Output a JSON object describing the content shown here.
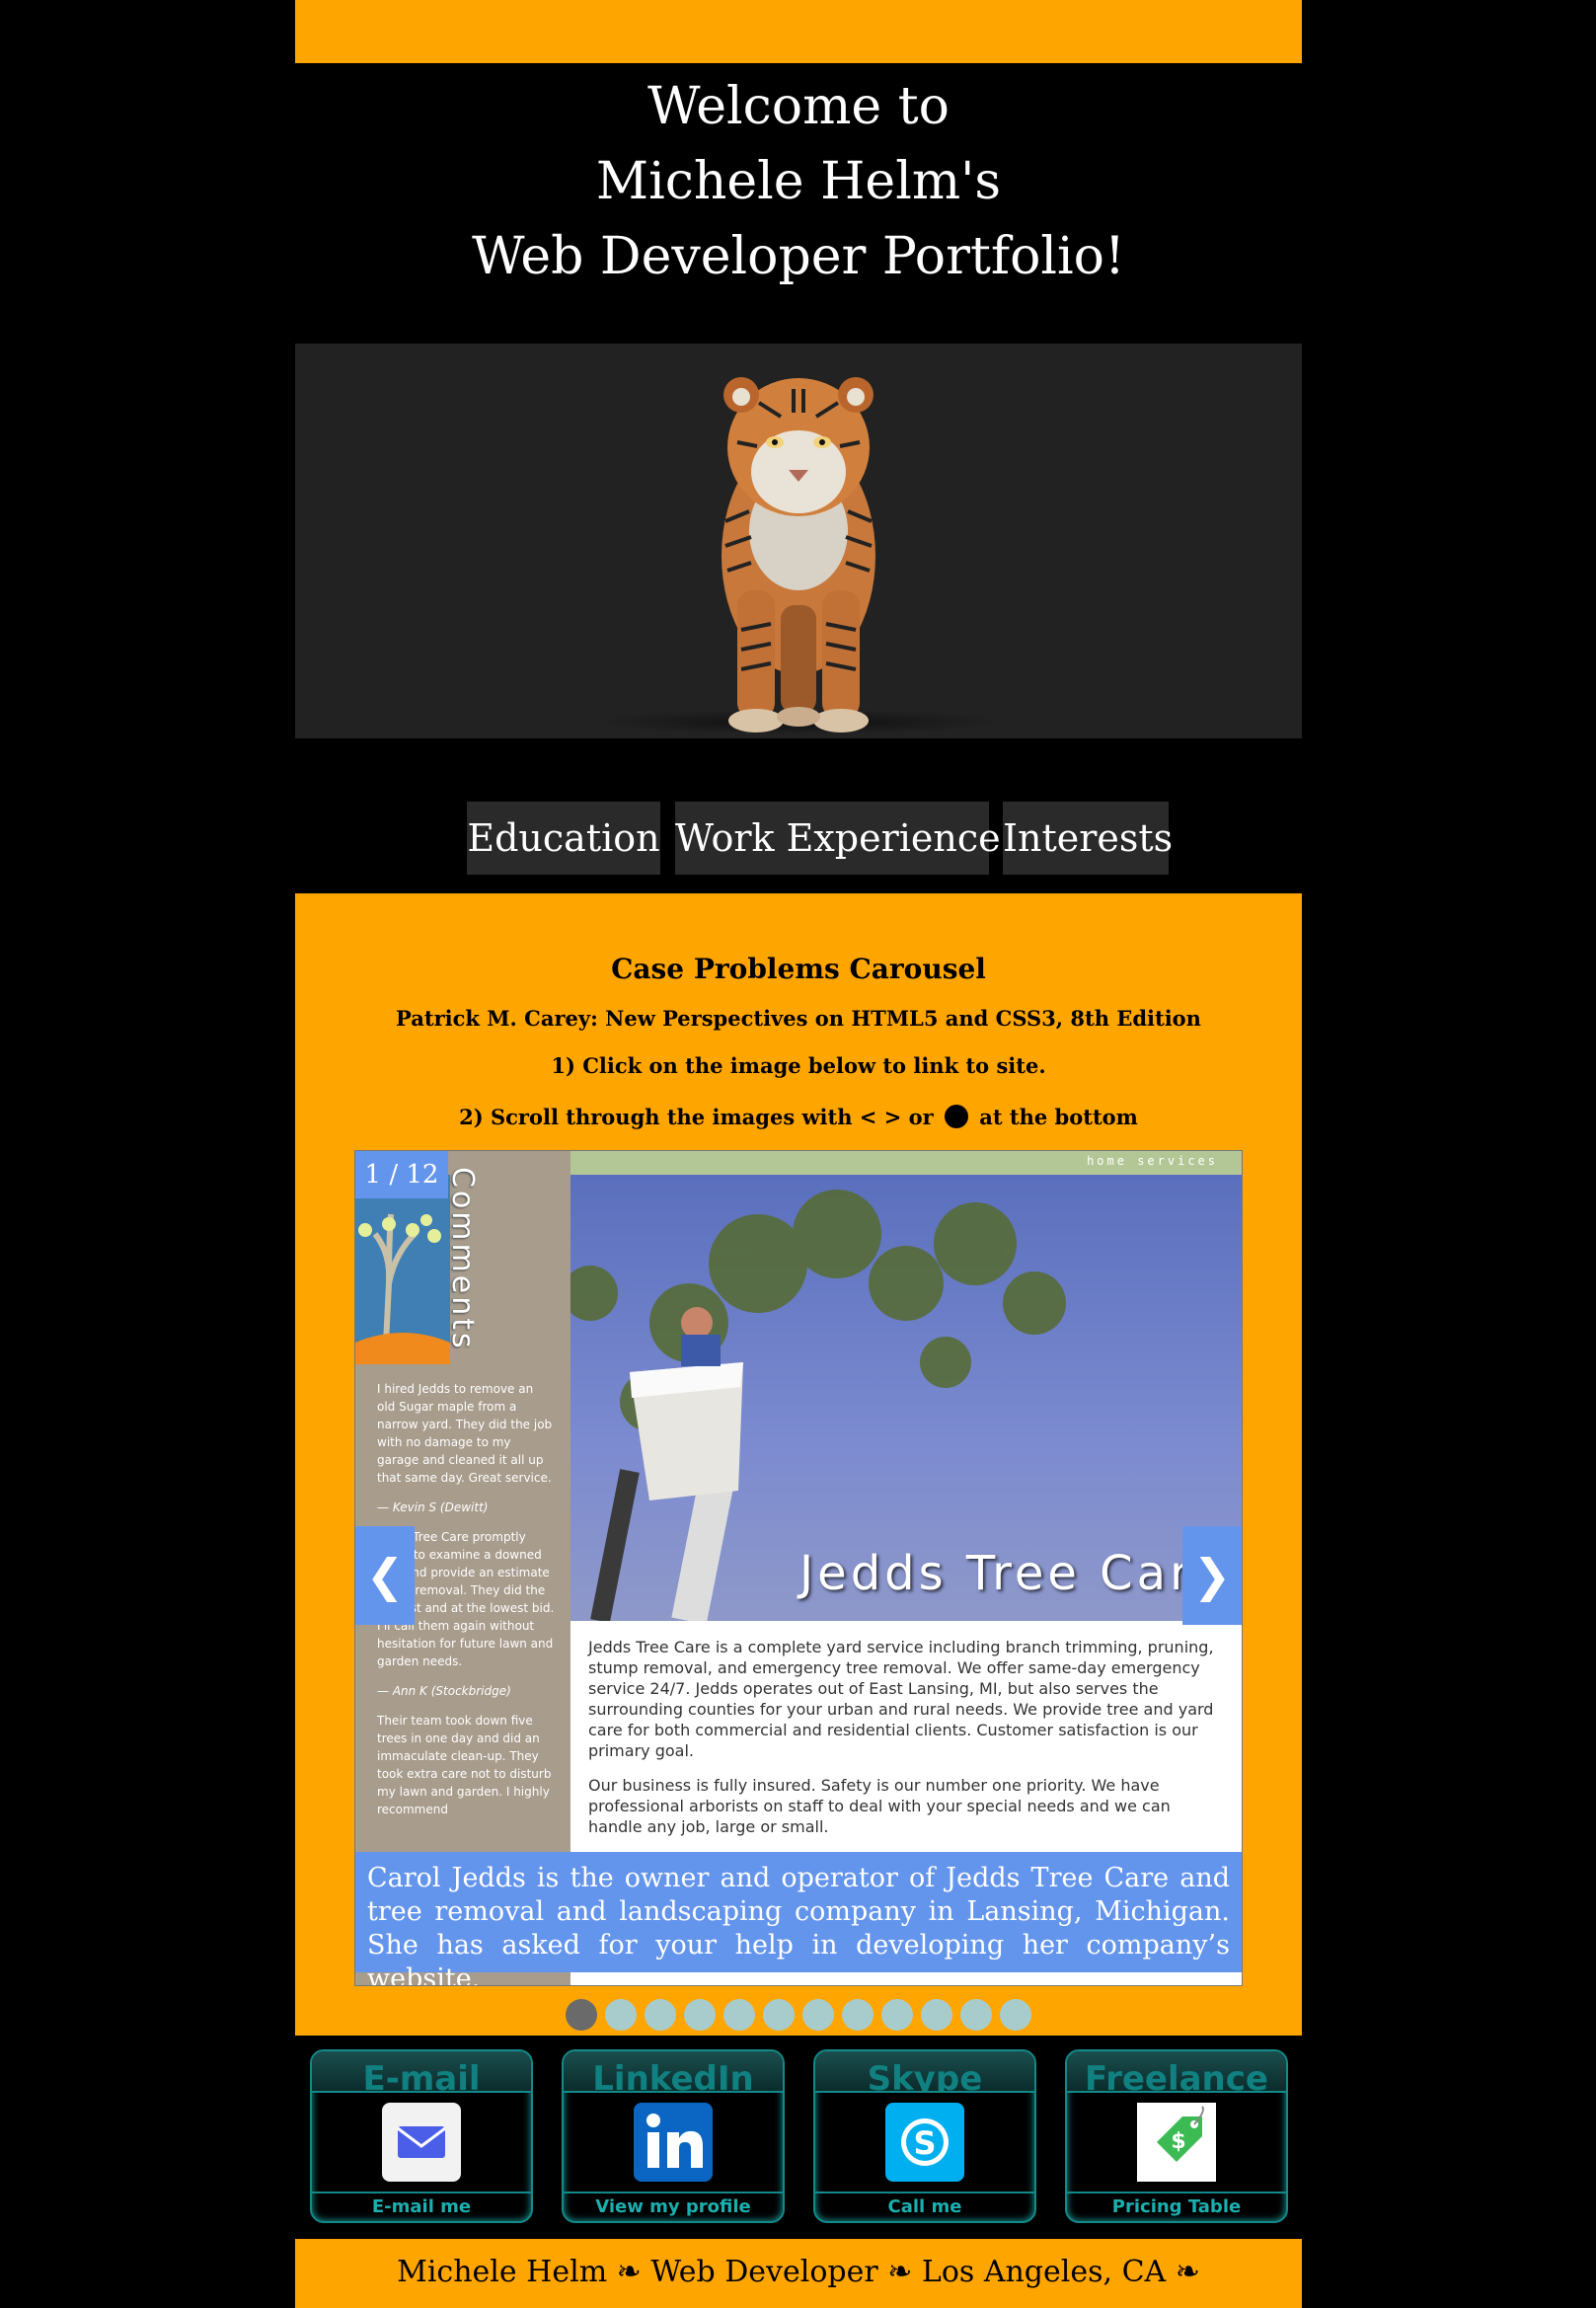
{
  "header": {
    "welcome_lines": [
      "Welcome to",
      "Michele Helm's",
      "Web Developer Portfolio!"
    ]
  },
  "nav": {
    "items": [
      {
        "label": "Education"
      },
      {
        "label": "Work Experience"
      },
      {
        "label": "Interests"
      }
    ]
  },
  "carousel": {
    "title": "Case Problems Carousel",
    "subtitle": "Patrick M. Carey: New Perspectives on HTML5 and CSS3, 8th Edition",
    "step1": "1) Click on the image below to link to site.",
    "step2_before": "2) Scroll through the images with < > or",
    "step2_after": "at the bottom",
    "counter": "1 / 12",
    "prev_label": "❮",
    "next_label": "❯",
    "slide": {
      "nav_text": "home   services",
      "comments_title": "Comments",
      "comments": [
        "I hired Jedds to remove an old Sugar maple from a narrow yard. They did the job with no damage to my garage and cleaned it all up that same day. Great service.",
        "— Kevin S (Dewitt)",
        "Jedds Tree Care promptly came to examine a downed tree and provide an estimate for its removal. They did the job fast and at the lowest bid. I'll call them again without hesitation for future lawn and garden needs.",
        "— Ann K (Stockbridge)",
        "Their team took down five trees in one day and did an immaculate clean-up. They took extra care not to disturb my lawn and garden. I highly recommend"
      ],
      "brand": "Jedds Tree Care",
      "desc_p1": "Jedds Tree Care is a complete yard service including branch trimming, pruning, stump removal, and emergency tree removal. We offer same-day emergency service 24/7. Jedds operates out of East Lansing, MI, but also serves the surrounding counties for your urban and rural needs. We provide tree and yard care for both commercial and residential clients. Customer satisfaction is our primary goal.",
      "desc_p2": "Our business is fully insured. Safety is our number one priority. We have professional arborists on staff to deal with your special needs and we can handle any job, large or small."
    },
    "caption": "Carol Jedds is the owner and operator of Jedds Tree Care and tree removal and landscaping company in Lansing, Michigan. She has asked for your help in developing her company’s website.",
    "dot_count": 12,
    "active_dot": 1
  },
  "contacts": [
    {
      "title": "E-mail",
      "link": "E-mail me",
      "icon": "envelope-icon"
    },
    {
      "title": "LinkedIn",
      "link": "View my profile",
      "icon": "linkedin-icon"
    },
    {
      "title": "Skype",
      "link": "Call me",
      "icon": "skype-icon"
    },
    {
      "title": "Freelance",
      "link": "Pricing Table",
      "icon": "price-tag-icon"
    }
  ],
  "footer": {
    "text": "Michele Helm ❧ Web Developer ❧ Los Angeles, CA ❧"
  },
  "colors": {
    "accent_orange": "#FFA500",
    "carousel_blue": "#6495ED",
    "teal": "#138A8A"
  }
}
